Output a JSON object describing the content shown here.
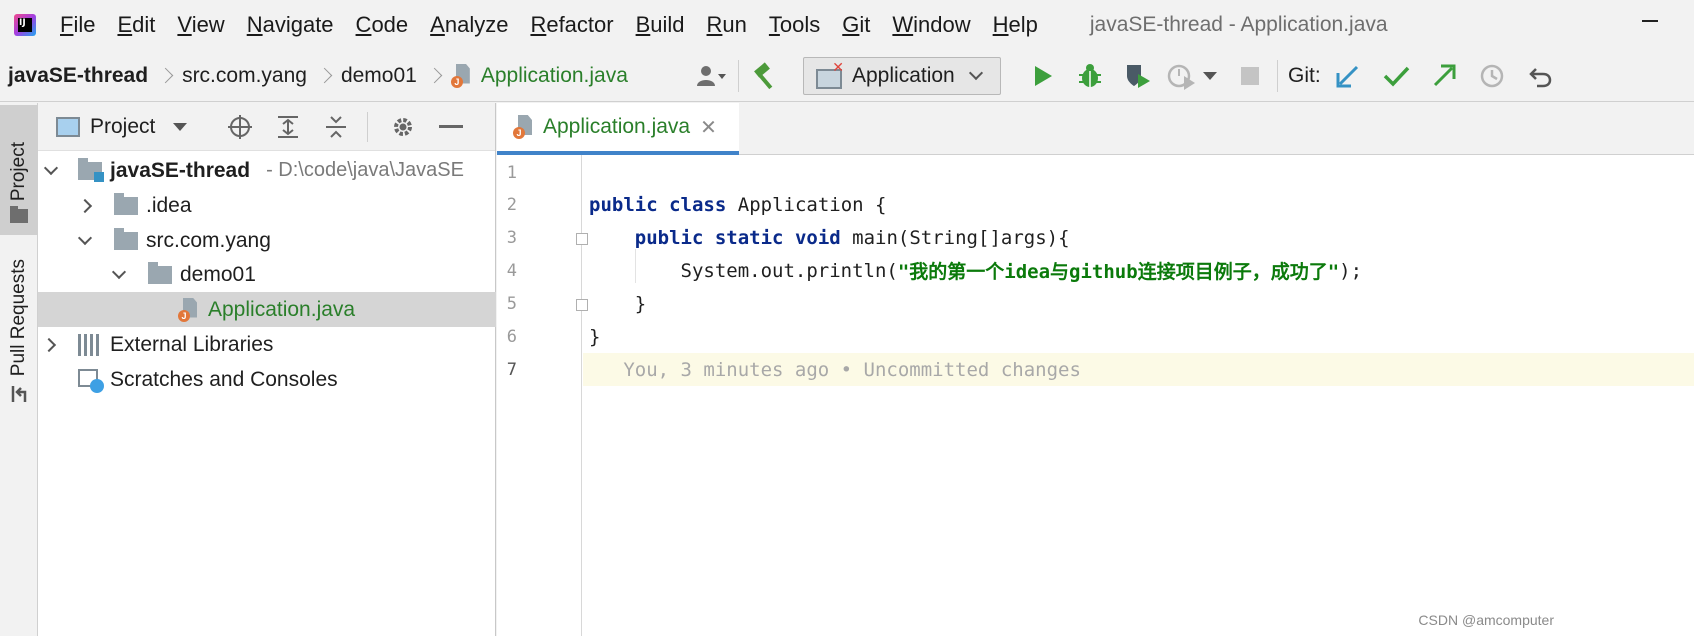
{
  "menubar": {
    "items": [
      "File",
      "Edit",
      "View",
      "Navigate",
      "Code",
      "Analyze",
      "Refactor",
      "Build",
      "Run",
      "Tools",
      "Git",
      "Window",
      "Help"
    ],
    "mnemonics": [
      "F",
      "E",
      "V",
      "N",
      "C",
      "A",
      "R",
      "B",
      "R",
      "T",
      "G",
      "W",
      "H"
    ],
    "window_title": "javaSE-thread - Application.java"
  },
  "breadcrumbs": [
    "javaSE-thread",
    "src.com.yang",
    "demo01",
    "Application.java"
  ],
  "toolbar": {
    "run_config": "Application",
    "git_label": "Git:"
  },
  "left_strip": {
    "project_tab": "Project",
    "pull_requests_tab": "Pull Requests"
  },
  "project_panel": {
    "title": "Project",
    "tree": [
      {
        "label": "javaSE-thread",
        "hint": "- D:\\code\\java\\JavaSE",
        "expanded": true,
        "level": 0
      },
      {
        "label": ".idea",
        "expanded": false,
        "level": 1
      },
      {
        "label": "src.com.yang",
        "expanded": true,
        "level": 1
      },
      {
        "label": "demo01",
        "expanded": true,
        "level": 2
      },
      {
        "label": "Application.java",
        "selected": true,
        "level": 3
      },
      {
        "label": "External Libraries",
        "expanded": false,
        "level": 0
      },
      {
        "label": "Scratches and Consoles",
        "level": 0
      }
    ]
  },
  "editor": {
    "tab_label": "Application.java",
    "line_numbers": [
      "1",
      "2",
      "3",
      "4",
      "5",
      "6",
      "7"
    ],
    "code": {
      "l2_kw1": "public",
      "l2_kw2": "class",
      "l2_rest": "Application {",
      "l3_kw1": "public",
      "l3_kw2": "static",
      "l3_kw3": "void",
      "l3_rest": "main(String[]args){",
      "l4_pre": "System.out.println(",
      "l4_str": "\"我的第一个idea与github连接项目例子，成功了\"",
      "l4_post": ");",
      "l5": "}",
      "l6": "}"
    },
    "blame": "You, 3 minutes ago • Uncommitted changes"
  },
  "watermark": "CSDN @amcomputer",
  "colors": {
    "keyword": "#0a2a8a",
    "string": "#0b7a0b",
    "accent_tab": "#4083c9",
    "selection": "#d5d5d5",
    "caret_line": "#fcfae6"
  }
}
